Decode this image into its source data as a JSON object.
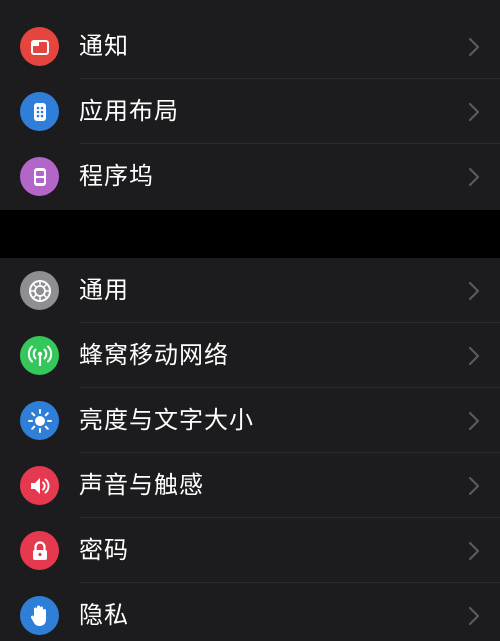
{
  "colors": {
    "background": "#000000",
    "cell": "#1c1c1e",
    "separator": "#2c2c2e",
    "chevron": "#5a5a5e",
    "partial_top": "#30c25a"
  },
  "settings": {
    "group1": [
      {
        "label": "通知",
        "icon": "notifications-icon",
        "color": "#e5453f"
      },
      {
        "label": "应用布局",
        "icon": "app-layout-icon",
        "color": "#2f7ed8"
      },
      {
        "label": "程序坞",
        "icon": "dock-icon",
        "color": "#b366c9"
      }
    ],
    "group2": [
      {
        "label": "通用",
        "icon": "gear-icon",
        "color": "#8e8e93"
      },
      {
        "label": "蜂窝移动网络",
        "icon": "cellular-icon",
        "color": "#34c759"
      },
      {
        "label": "亮度与文字大小",
        "icon": "brightness-icon",
        "color": "#2f7ed8"
      },
      {
        "label": "声音与触感",
        "icon": "speaker-icon",
        "color": "#e5394f"
      },
      {
        "label": "密码",
        "icon": "lock-icon",
        "color": "#e5394f"
      },
      {
        "label": "隐私",
        "icon": "privacy-hand-icon",
        "color": "#2f7ed8"
      }
    ]
  }
}
